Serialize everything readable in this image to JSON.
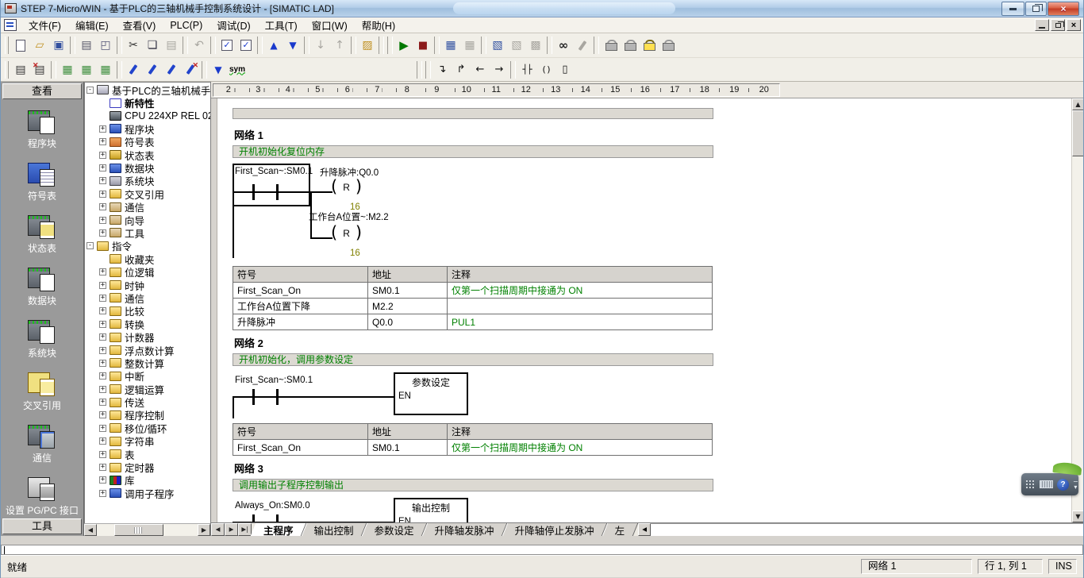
{
  "window": {
    "title": "STEP 7-Micro/WIN - 基于PLC的三轴机械手控制系统设计 - [SIMATIC LAD]"
  },
  "menu": {
    "items": [
      "文件(F)",
      "编辑(E)",
      "查看(V)",
      "PLC(P)",
      "调试(D)",
      "工具(T)",
      "窗口(W)",
      "帮助(H)"
    ]
  },
  "toolbar1": {
    "items": [
      {
        "name": "new-file",
        "glyph": "▯"
      },
      {
        "name": "open-project",
        "glyph": "▱"
      },
      {
        "name": "save-project",
        "glyph": "▣"
      },
      {
        "name": "separator"
      },
      {
        "name": "print",
        "glyph": "▤"
      },
      {
        "name": "print-preview",
        "glyph": "◰"
      },
      {
        "name": "separator"
      },
      {
        "name": "cut",
        "glyph": "✂"
      },
      {
        "name": "copy",
        "glyph": "❏"
      },
      {
        "name": "paste",
        "glyph": "▤",
        "disabled": true
      },
      {
        "name": "separator"
      },
      {
        "name": "undo",
        "glyph": "↶",
        "disabled": true
      },
      {
        "name": "separator"
      },
      {
        "name": "compile",
        "glyph": "✓"
      },
      {
        "name": "compile-all",
        "glyph": "✓"
      },
      {
        "name": "separator"
      },
      {
        "name": "upload",
        "glyph": "▲"
      },
      {
        "name": "download",
        "glyph": "▼"
      },
      {
        "name": "separator"
      },
      {
        "name": "sort-ascending",
        "glyph": "↓",
        "disabled": true
      },
      {
        "name": "sort-descending",
        "glyph": "↑",
        "disabled": true
      },
      {
        "name": "separator"
      },
      {
        "name": "options",
        "glyph": "▨"
      },
      {
        "name": "separator"
      },
      {
        "name": "separator"
      },
      {
        "name": "run",
        "glyph": "▶"
      },
      {
        "name": "stop",
        "glyph": "■"
      },
      {
        "name": "separator"
      },
      {
        "name": "program-status",
        "glyph": "▦"
      },
      {
        "name": "pause-program-status",
        "glyph": "▦",
        "disabled": true
      },
      {
        "name": "separator"
      },
      {
        "name": "chart-status",
        "glyph": "▧"
      },
      {
        "name": "pause-chart-status",
        "glyph": "▧",
        "disabled": true
      },
      {
        "name": "read-all",
        "glyph": "▩",
        "disabled": true
      },
      {
        "name": "separator"
      },
      {
        "name": "find",
        "glyph": "∞"
      },
      {
        "name": "pen-edit",
        "glyph": "",
        "disabled": true
      },
      {
        "name": "separator"
      },
      {
        "name": "bookmark-lock-toggle",
        "glyph": "",
        "disabled": true
      },
      {
        "name": "bookmark-lock-next",
        "glyph": "",
        "disabled": true
      },
      {
        "name": "bookmark-lock-current",
        "glyph": ""
      },
      {
        "name": "bookmark-lock-clear",
        "glyph": "",
        "disabled": true
      }
    ]
  },
  "toolbar2": {
    "items": [
      {
        "name": "insert-network",
        "glyph": "▤"
      },
      {
        "name": "delete-network",
        "glyph": "▤"
      },
      {
        "name": "separator"
      },
      {
        "name": "toggle-pou-comments",
        "glyph": "▦"
      },
      {
        "name": "toggle-network-comments",
        "glyph": "▦"
      },
      {
        "name": "toggle-symbol-info-tables",
        "glyph": "▦"
      },
      {
        "name": "separator"
      },
      {
        "name": "bookmark-pen-toggle",
        "glyph": ""
      },
      {
        "name": "bookmark-pen-next",
        "glyph": ""
      },
      {
        "name": "bookmark-pen-previous",
        "glyph": ""
      },
      {
        "name": "bookmark-pen-clear",
        "glyph": ""
      },
      {
        "name": "separator"
      },
      {
        "name": "apply-symbols",
        "glyph": "▼"
      },
      {
        "name": "symbol-table-sym",
        "glyph": "sym"
      },
      {
        "name": "spacer"
      },
      {
        "name": "separator"
      },
      {
        "name": "separator"
      },
      {
        "name": "line-down",
        "glyph": "↴"
      },
      {
        "name": "line-up",
        "glyph": "↱"
      },
      {
        "name": "line-left",
        "glyph": "←"
      },
      {
        "name": "line-right",
        "glyph": "→"
      },
      {
        "name": "separator"
      },
      {
        "name": "insert-contact",
        "glyph": "┤├"
      },
      {
        "name": "insert-coil",
        "glyph": "( )"
      },
      {
        "name": "insert-box",
        "glyph": "▯"
      }
    ]
  },
  "viewbar": {
    "header": "查看",
    "footer": "工具",
    "items": [
      {
        "label": "程序块",
        "icon": "program-block"
      },
      {
        "label": "符号表",
        "icon": "symbol-table"
      },
      {
        "label": "状态表",
        "icon": "status-table"
      },
      {
        "label": "数据块",
        "icon": "data-block"
      },
      {
        "label": "系统块",
        "icon": "system-block"
      },
      {
        "label": "交叉引用",
        "icon": "cross-ref"
      },
      {
        "label": "通信",
        "icon": "communications"
      },
      {
        "label": "设置 PG/PC 接口",
        "icon": "pg-pc-interface"
      }
    ]
  },
  "tree": {
    "items": [
      {
        "label": "基于PLC的三轴机械手",
        "level": 0,
        "exp": "minus",
        "exp_char": "-",
        "icon": "project"
      },
      {
        "label": "新特性",
        "level": 1,
        "exp": "none",
        "exp_char": "",
        "icon": "question",
        "bold": true
      },
      {
        "label": "CPU 224XP REL 02",
        "level": 1,
        "exp": "none",
        "exp_char": "",
        "icon": "cpu"
      },
      {
        "label": "程序块",
        "level": 1,
        "exp": "plus",
        "exp_char": "+",
        "icon": "program-block"
      },
      {
        "label": "符号表",
        "level": 1,
        "exp": "plus",
        "exp_char": "+",
        "icon": "symbol-table"
      },
      {
        "label": "状态表",
        "level": 1,
        "exp": "plus",
        "exp_char": "+",
        "icon": "status-table"
      },
      {
        "label": "数据块",
        "level": 1,
        "exp": "plus",
        "exp_char": "+",
        "icon": "data-block"
      },
      {
        "label": "系统块",
        "level": 1,
        "exp": "plus",
        "exp_char": "+",
        "icon": "system-block"
      },
      {
        "label": "交叉引用",
        "level": 1,
        "exp": "plus",
        "exp_char": "+",
        "icon": "cross-ref"
      },
      {
        "label": "通信",
        "level": 1,
        "exp": "plus",
        "exp_char": "+",
        "icon": "comm"
      },
      {
        "label": "向导",
        "level": 1,
        "exp": "plus",
        "exp_char": "+",
        "icon": "wizard"
      },
      {
        "label": "工具",
        "level": 1,
        "exp": "plus",
        "exp_char": "+",
        "icon": "tools"
      },
      {
        "label": "指令",
        "level": 0,
        "exp": "minus",
        "exp_char": "-",
        "icon": "instructions"
      },
      {
        "label": "收藏夹",
        "level": 1,
        "exp": "none",
        "exp_char": "",
        "icon": "favorites"
      },
      {
        "label": "位逻辑",
        "level": 1,
        "exp": "plus",
        "exp_char": "+",
        "icon": "bit-logic"
      },
      {
        "label": "时钟",
        "level": 1,
        "exp": "plus",
        "exp_char": "+",
        "icon": "clock"
      },
      {
        "label": "通信",
        "level": 1,
        "exp": "plus",
        "exp_char": "+",
        "icon": "comm-instr"
      },
      {
        "label": "比较",
        "level": 1,
        "exp": "plus",
        "exp_char": "+",
        "icon": "compare"
      },
      {
        "label": "转换",
        "level": 1,
        "exp": "plus",
        "exp_char": "+",
        "icon": "convert"
      },
      {
        "label": "计数器",
        "level": 1,
        "exp": "plus",
        "exp_char": "+",
        "icon": "counter"
      },
      {
        "label": "浮点数计算",
        "level": 1,
        "exp": "plus",
        "exp_char": "+",
        "icon": "float-math"
      },
      {
        "label": "整数计算",
        "level": 1,
        "exp": "plus",
        "exp_char": "+",
        "icon": "int-math"
      },
      {
        "label": "中断",
        "level": 1,
        "exp": "plus",
        "exp_char": "+",
        "icon": "interrupt"
      },
      {
        "label": "逻辑运算",
        "level": 1,
        "exp": "plus",
        "exp_char": "+",
        "icon": "logic-ops"
      },
      {
        "label": "传送",
        "level": 1,
        "exp": "plus",
        "exp_char": "+",
        "icon": "move"
      },
      {
        "label": "程序控制",
        "level": 1,
        "exp": "plus",
        "exp_char": "+",
        "icon": "program-control"
      },
      {
        "label": "移位/循环",
        "level": 1,
        "exp": "plus",
        "exp_char": "+",
        "icon": "shift-rotate"
      },
      {
        "label": "字符串",
        "level": 1,
        "exp": "plus",
        "exp_char": "+",
        "icon": "string"
      },
      {
        "label": "表",
        "level": 1,
        "exp": "plus",
        "exp_char": "+",
        "icon": "table"
      },
      {
        "label": "定时器",
        "level": 1,
        "exp": "plus",
        "exp_char": "+",
        "icon": "timer"
      },
      {
        "label": "库",
        "level": 1,
        "exp": "plus",
        "exp_char": "+",
        "icon": "library"
      },
      {
        "label": "调用子程序",
        "level": 1,
        "exp": "plus",
        "exp_char": "+",
        "icon": "subroutine"
      }
    ]
  },
  "ruler": {
    "numbers": [
      "2",
      "3",
      "4",
      "5",
      "6",
      "7",
      "8",
      "9",
      "10",
      "11",
      "12",
      "13",
      "14",
      "15",
      "16",
      "17",
      "18",
      "19",
      "20"
    ]
  },
  "editor": {
    "networks": [
      {
        "title": "网络 1",
        "comment": "开机初始化复位内存",
        "ladder": {
          "contact": "First_Scan~:SM0.1",
          "coil1_label": "升降脉冲:Q0.0",
          "coil1_type": "R",
          "coil1_count": "16",
          "coil2_label": "工作台A位置~:M2.2",
          "coil2_type": "R",
          "coil2_count": "16"
        },
        "table": {
          "headers": [
            "符号",
            "地址",
            "注释"
          ],
          "rows": [
            [
              "First_Scan_On",
              "SM0.1",
              "仅第一个扫描周期中接通为 ON"
            ],
            [
              "工作台A位置下降",
              "M2.2",
              ""
            ],
            [
              "升降脉冲",
              "Q0.0",
              "PUL1"
            ]
          ]
        }
      },
      {
        "title": "网络 2",
        "comment": "开机初始化，调用参数设定",
        "ladder": {
          "contact": "First_Scan~:SM0.1",
          "box_title": "参数设定",
          "box_pin": "EN"
        },
        "table": {
          "headers": [
            "符号",
            "地址",
            "注释"
          ],
          "rows": [
            [
              "First_Scan_On",
              "SM0.1",
              "仅第一个扫描周期中接通为 ON"
            ]
          ]
        }
      },
      {
        "title": "网络 3",
        "comment": "调用输出子程序控制输出",
        "ladder": {
          "contact": "Always_On:SM0.0",
          "box_title": "输出控制",
          "box_pin": "EN"
        }
      }
    ]
  },
  "tabs": {
    "nav": [
      "◀",
      "▶",
      "▶|"
    ],
    "scroll_left": "◀",
    "items": [
      {
        "label": "主程序",
        "active": true
      },
      {
        "label": "输出控制"
      },
      {
        "label": "参数设定"
      },
      {
        "label": "升降轴发脉冲"
      },
      {
        "label": "升降轴停止发脉冲"
      },
      {
        "label": "左"
      }
    ]
  },
  "statusbar": {
    "ready": "就绪",
    "cells": [
      "网络 1",
      "行 1, 列 1",
      "INS"
    ]
  },
  "ime": {
    "help": "?",
    "minimize": "−",
    "expand": "▾"
  },
  "colors": {
    "comment_green": "#008000",
    "count_olive": "#808000",
    "titlebar_blue": "#b3cde8",
    "close_red": "#c23a24"
  }
}
